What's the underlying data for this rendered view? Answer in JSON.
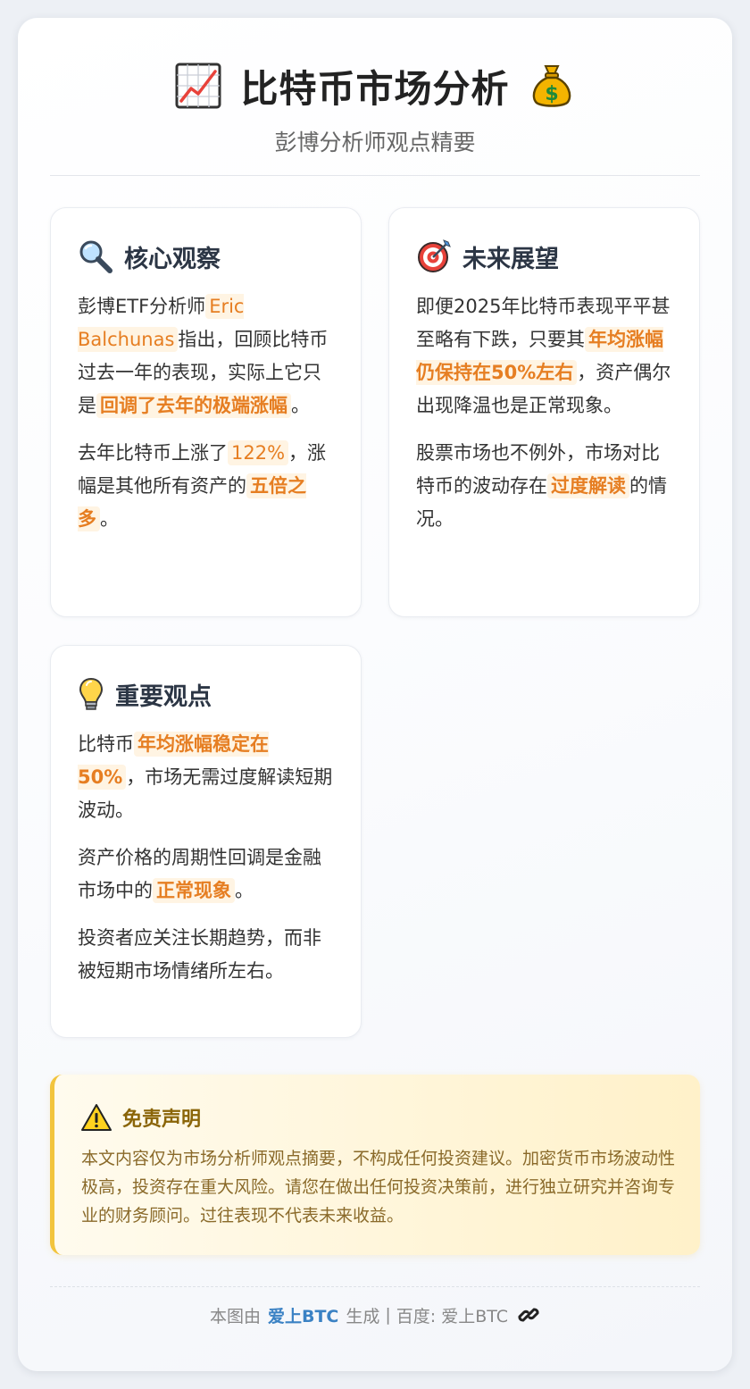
{
  "header": {
    "title": "比特币市场分析",
    "subtitle": "彭博分析师观点精要",
    "left_icon": "chart-increasing-icon",
    "right_icon": "money-bag-icon"
  },
  "cards": [
    {
      "title": "核心观察",
      "icon": "magnifier-icon",
      "p1": {
        "t1": "彭博ETF分析师",
        "h1": "Eric Balchunas",
        "t2": "指出，回顾比特币过去一年的表现，实际上它只是",
        "h2": "回调了去年的极端涨幅",
        "t3": "。"
      },
      "p2": {
        "t1": "去年比特币上涨了",
        "h1": "122%",
        "t2": "，涨幅是其他所有资产的",
        "h2": "五倍之多",
        "t3": "。"
      }
    },
    {
      "title": "未来展望",
      "icon": "target-icon",
      "p1": {
        "t1": "即便2025年比特币表现平平甚至略有下跌，只要其",
        "h1": "年均涨幅仍保持在50%左右",
        "t2": "，资产偶尔出现降温也是正常现象。"
      },
      "p2": {
        "t1": "股票市场也不例外，市场对比特币的波动存在",
        "h1": "过度解读",
        "t2": "的情况。"
      }
    },
    {
      "title": "重要观点",
      "icon": "lightbulb-icon",
      "p1": {
        "t1": "比特币",
        "h1": "年均涨幅稳定在50%",
        "t2": "，市场无需过度解读短期波动。"
      },
      "p2": {
        "t1": "资产价格的周期性回调是金融市场中的",
        "h1": "正常现象",
        "t2": "。"
      },
      "p3": {
        "t1": "投资者应关注长期趋势，而非被短期市场情绪所左右。"
      }
    }
  ],
  "disclaimer": {
    "icon": "warning-icon",
    "title": "免责声明",
    "text": "本文内容仅为市场分析师观点摘要，不构成任何投资建议。加密货币市场波动性极高，投资存在重大风险。请您在做出任何投资决策前，进行独立研究并咨询专业的财务顾问。过往表现不代表未来收益。"
  },
  "footer": {
    "prefix": "本图由",
    "brand": "爱上BTC",
    "suffix": "生成",
    "separator": "|",
    "baidu": "百度: 爱上BTC",
    "icon": "link-icon"
  },
  "colors": {
    "highlight_text": "#e67e22",
    "highlight_bg": "#fff4e3",
    "brand": "#3b82c4",
    "disclaimer_border": "#f2c43d",
    "disclaimer_title": "#8a6508"
  }
}
